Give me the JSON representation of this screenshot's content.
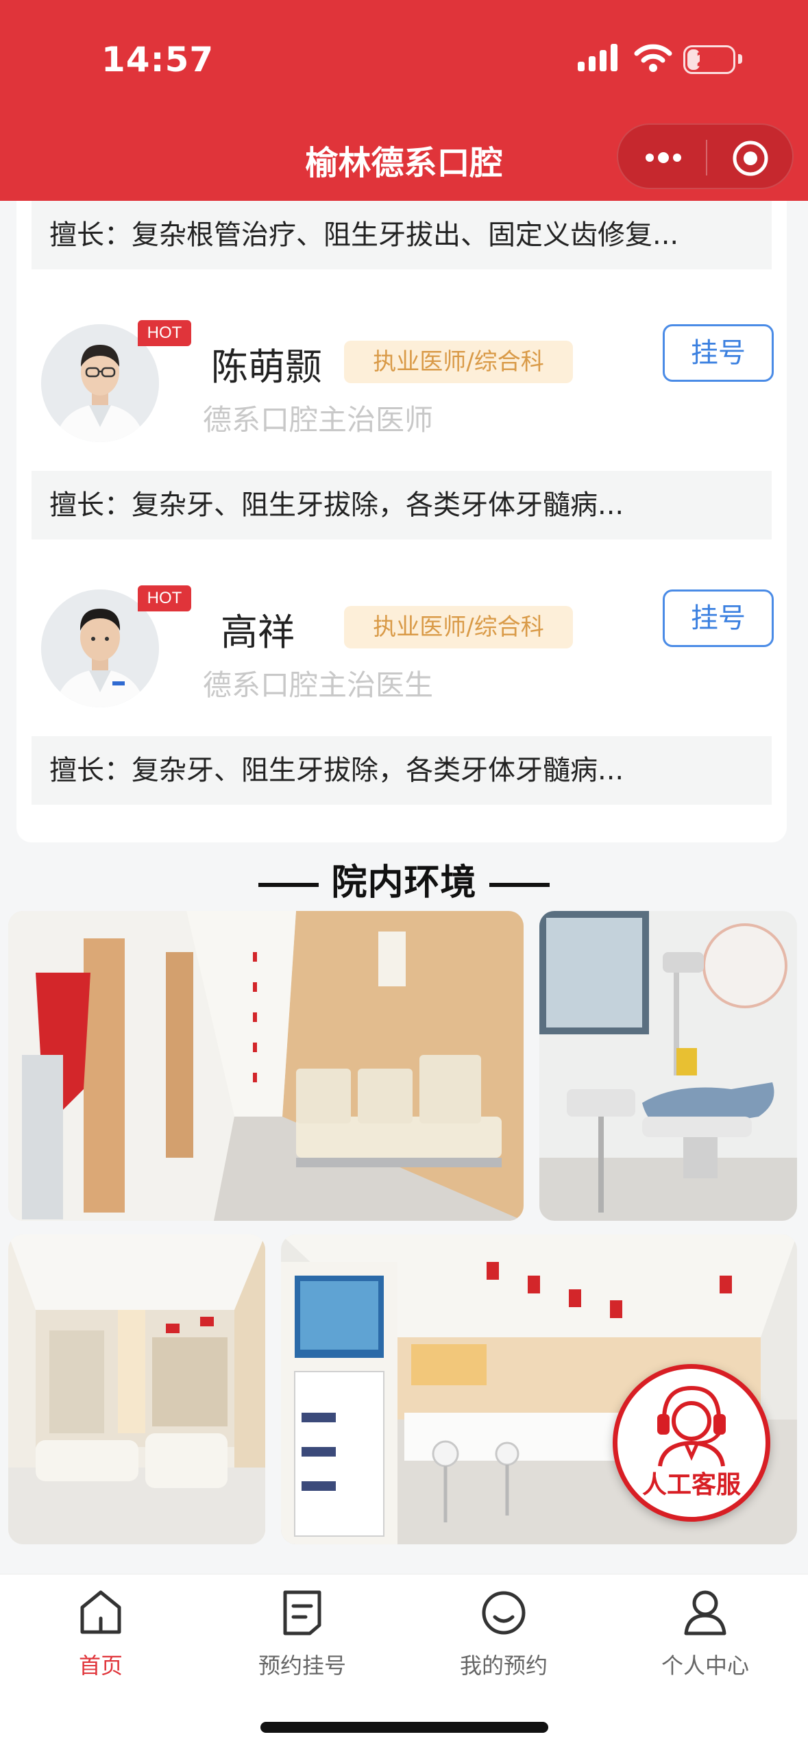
{
  "status_bar": {
    "time": "14:57",
    "battery": "28",
    "battery_level": 0.28
  },
  "nav": {
    "title": "榆林德系口腔"
  },
  "doctors": {
    "prev_specialty": "擅长：复杂根管治疗、阻生牙拔出、固定义齿修复...",
    "items": [
      {
        "badge": "HOT",
        "name": "陈萌颢",
        "tag": "执业医师/综合科",
        "title": "德系口腔主治医师",
        "register": "挂号",
        "specialty": "擅长：复杂牙、阻生牙拔除，各类牙体牙髓病..."
      },
      {
        "badge": "HOT",
        "name": "高祥",
        "tag": "执业医师/综合科",
        "title": "德系口腔主治医生",
        "register": "挂号",
        "specialty": "擅长：复杂牙、阻生牙拔除，各类牙体牙髓病..."
      }
    ]
  },
  "environment": {
    "heading": "院内环境"
  },
  "customer_service": {
    "label": "人工客服"
  },
  "tabbar": {
    "items": [
      {
        "label": "首页",
        "icon": "home-icon",
        "active": true
      },
      {
        "label": "预约挂号",
        "icon": "document-icon",
        "active": false
      },
      {
        "label": "我的预约",
        "icon": "smile-icon",
        "active": false
      },
      {
        "label": "个人中心",
        "icon": "person-icon",
        "active": false
      }
    ]
  },
  "colors": {
    "brand": "#e0343a",
    "link": "#3b80e0",
    "tag_bg": "#fdefd9",
    "tag_text": "#d99a47"
  }
}
